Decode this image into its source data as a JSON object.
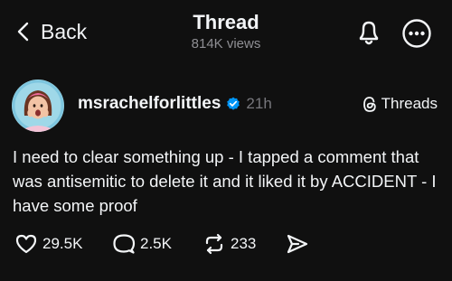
{
  "header": {
    "back_label": "Back",
    "title": "Thread",
    "views": "814K views",
    "icons": [
      "chevron-left-icon",
      "bell-icon",
      "more-icon"
    ]
  },
  "post": {
    "username": "msrachelforlittles",
    "time": "21h",
    "threads_label": "Threads",
    "text": "I need to clear something up - I tapped a comment that was antisemitic to delete it and it liked it by ACCIDENT - I have some proof",
    "likes": "29.5K",
    "replies": "2.5K",
    "reposts": "233",
    "verified_color": "#0095f6"
  },
  "colors": {
    "background": "#101010",
    "text": "#f3f5f7",
    "muted": "#8f8f94"
  }
}
